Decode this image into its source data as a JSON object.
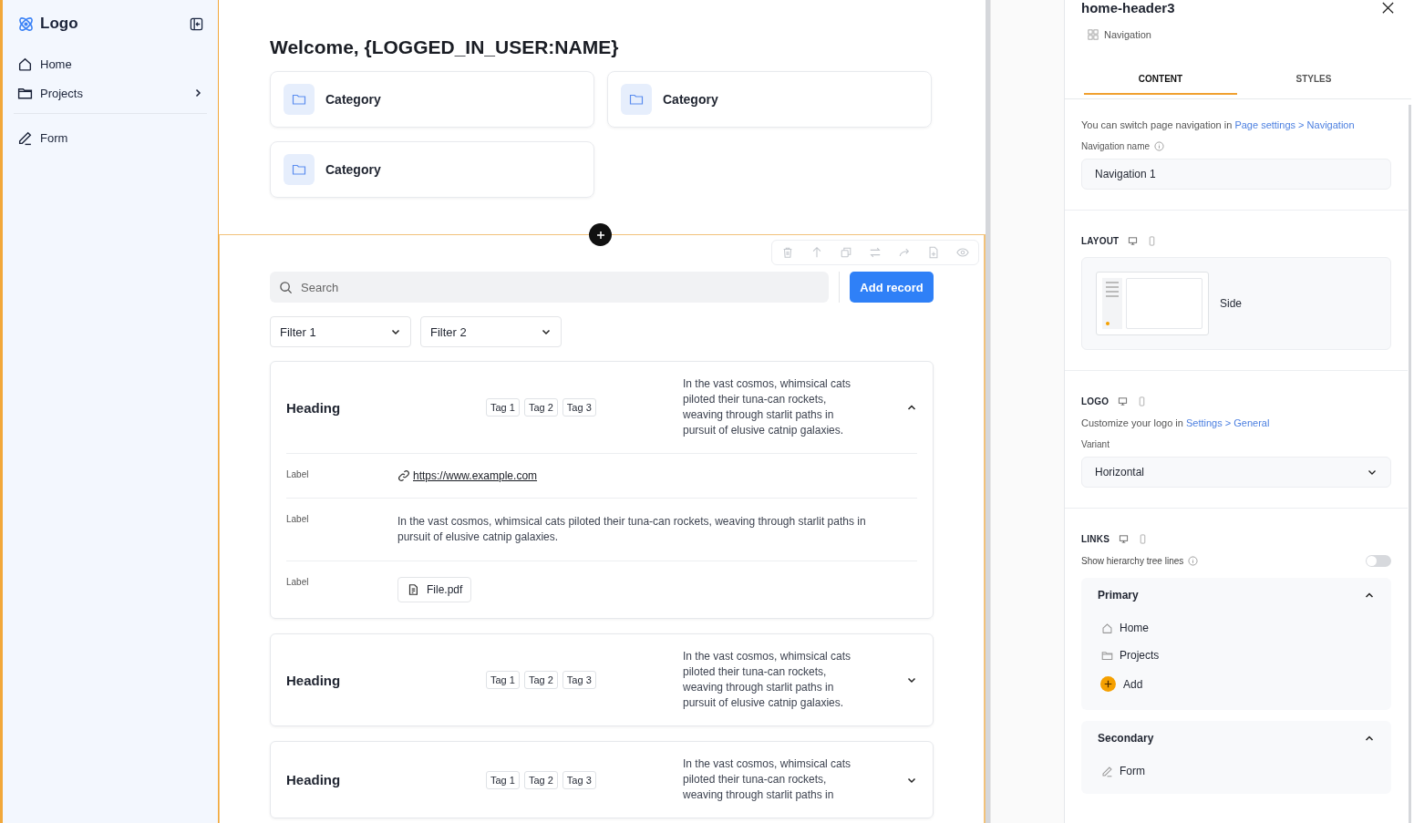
{
  "sidebar": {
    "logo": "Logo",
    "groups": [
      {
        "items": [
          {
            "label": "Home",
            "kind": "home",
            "has_children": false
          },
          {
            "label": "Projects",
            "kind": "folder",
            "has_children": true
          }
        ]
      },
      {
        "items": [
          {
            "label": "Form",
            "kind": "pen",
            "has_children": false
          }
        ]
      }
    ]
  },
  "main": {
    "title": "Welcome, {LOGGED_IN_USER:NAME}",
    "categories": [
      "Category",
      "Category",
      "Category"
    ],
    "search": {
      "placeholder": "Search"
    },
    "add_button": "Add record",
    "filters": [
      "Filter 1",
      "Filter 2"
    ],
    "records": [
      {
        "heading": "Heading",
        "tags": [
          "Tag 1",
          "Tag 2",
          "Tag 3"
        ],
        "description": "In the vast cosmos, whimsical cats piloted their tuna-can rockets, weaving through starlit paths in pursuit of elusive catnip galaxies.",
        "expanded": true,
        "fields": [
          {
            "label": "Label",
            "kind": "link",
            "value": "https://www.example.com"
          },
          {
            "label": "Label",
            "kind": "text",
            "value": "In the vast cosmos, whimsical cats piloted their tuna-can rockets, weaving through starlit paths in pursuit of elusive catnip galaxies."
          },
          {
            "label": "Label",
            "kind": "file",
            "value": "File.pdf"
          }
        ]
      },
      {
        "heading": "Heading",
        "tags": [
          "Tag 1",
          "Tag 2",
          "Tag 3"
        ],
        "description": "In the vast cosmos, whimsical cats piloted their tuna-can rockets, weaving through starlit paths in pursuit of elusive catnip galaxies.",
        "expanded": false
      },
      {
        "heading": "Heading",
        "tags": [
          "Tag 1",
          "Tag 2",
          "Tag 3"
        ],
        "description": "In the vast cosmos, whimsical cats piloted their tuna-can rockets, weaving through starlit paths in",
        "expanded": false
      }
    ]
  },
  "panel": {
    "title": "home-header3",
    "type": "Navigation",
    "tabs": [
      {
        "label": "CONTENT",
        "selected": true
      },
      {
        "label": "STYLES",
        "selected": false
      }
    ],
    "note": "You can switch page navigation in ",
    "note_link": "Page settings > Navigation",
    "name_label": "Navigation name",
    "name_value": "Navigation 1",
    "layout": {
      "heading": "LAYOUT",
      "option": "Side"
    },
    "logo": {
      "heading": "LOGO",
      "note": "Customize your logo in ",
      "note_link": "Settings > General",
      "variant_label": "Variant",
      "variant": "Horizontal"
    },
    "links": {
      "heading": "LINKS",
      "toggle_label": "Show hierarchy tree lines",
      "tree_lines": false,
      "groups": [
        {
          "title": "Primary",
          "expanded": true,
          "items": [
            {
              "label": "Home",
              "kind": "home"
            },
            {
              "label": "Projects",
              "kind": "folder"
            }
          ],
          "add": "Add"
        },
        {
          "title": "Secondary",
          "expanded": true,
          "items": [
            {
              "label": "Form",
              "kind": "pen"
            }
          ]
        }
      ]
    }
  }
}
